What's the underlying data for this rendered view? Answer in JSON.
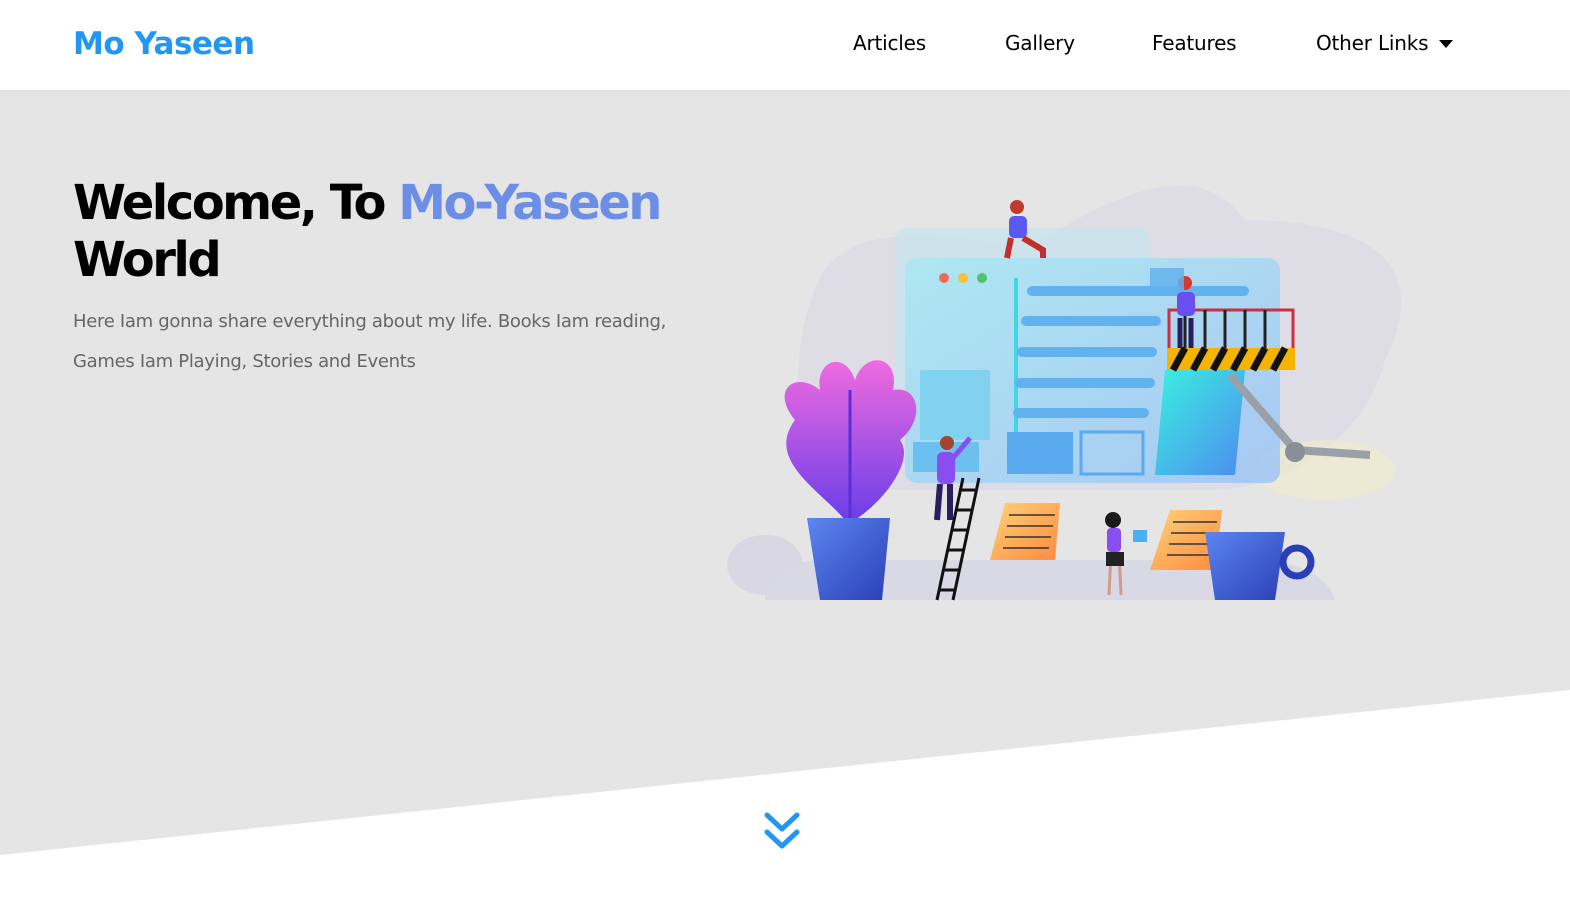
{
  "header": {
    "logo": "Mo Yaseen",
    "nav": {
      "articles": "Articles",
      "gallery": "Gallery",
      "features": "Features",
      "other_links": "Other Links"
    }
  },
  "landing": {
    "title_part1": "Welcome, To ",
    "title_accent": "Mo-Yaseen",
    "title_part2": "World",
    "description": "Here Iam gonna share everything about my life. Books Iam reading, Games Iam Playing, Stories and Events"
  },
  "icons": {
    "dropdown": "caret-down-icon",
    "go_down": "double-chevron-down-icon"
  },
  "colors": {
    "brand": "#2196f3",
    "accent": "#6d8ee6",
    "landing_bg": "#e5e5e5",
    "text_muted": "#666666"
  }
}
